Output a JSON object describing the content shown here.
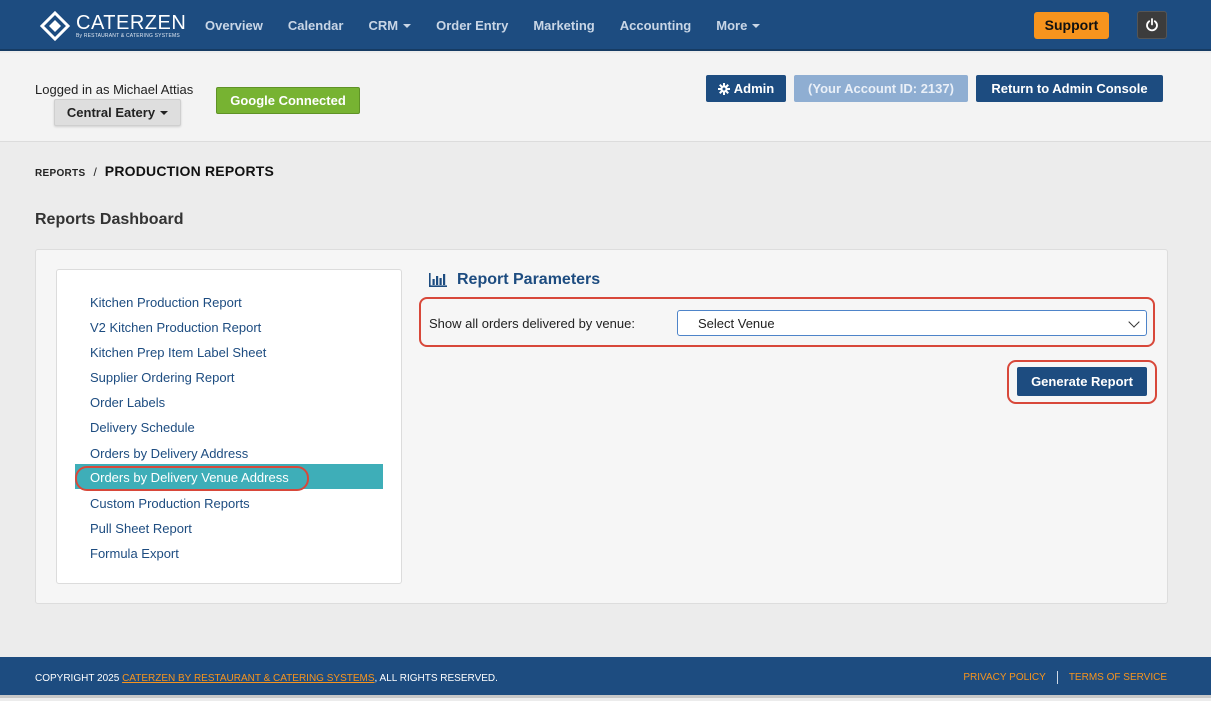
{
  "brand": {
    "name": "CATERZEN",
    "tagline": "By RESTAURANT & CATERING SYSTEMS",
    "accent": "#1d4c80",
    "orange": "#f7941d"
  },
  "nav": {
    "items": [
      {
        "label": "Overview",
        "dropdown": false
      },
      {
        "label": "Calendar",
        "dropdown": false
      },
      {
        "label": "CRM",
        "dropdown": true
      },
      {
        "label": "Order Entry",
        "dropdown": false
      },
      {
        "label": "Marketing",
        "dropdown": false
      },
      {
        "label": "Accounting",
        "dropdown": false
      },
      {
        "label": "More",
        "dropdown": true
      }
    ],
    "support_label": "Support",
    "power_icon": "power-icon"
  },
  "account": {
    "logged_in_text": "Logged in as Michael Attias",
    "venue": "Central Eatery",
    "google_label": "Google Connected",
    "admin_label": "Admin",
    "account_id_text": "(Your Account ID: 2137)",
    "return_label": "Return to Admin Console"
  },
  "breadcrumb": {
    "parent": "REPORTS",
    "separator": "/",
    "current": "PRODUCTION REPORTS"
  },
  "dashboard_title": "Reports Dashboard",
  "sidebar": {
    "items": [
      "Kitchen Production Report",
      "V2 Kitchen Production Report",
      "Kitchen Prep Item Label Sheet",
      "Supplier Ordering Report",
      "Order Labels",
      "Delivery Schedule",
      "Orders by Delivery Address",
      "Orders by Delivery Venue Address",
      "Custom Production Reports",
      "Pull Sheet Report",
      "Formula Export"
    ],
    "active_index": 7
  },
  "params": {
    "title": "Report Parameters",
    "label": "Show all orders delivered by venue:",
    "select_value": "Select Venue",
    "generate_label": "Generate Report"
  },
  "footer": {
    "copyright_prefix": "COPYRIGHT 2025",
    "company_link": "CATERZEN BY RESTAURANT & CATERING SYSTEMS",
    "copyright_suffix": ", ALL RIGHTS RESERVED.",
    "privacy": "PRIVACY POLICY",
    "terms": "TERMS OF SERVICE"
  }
}
